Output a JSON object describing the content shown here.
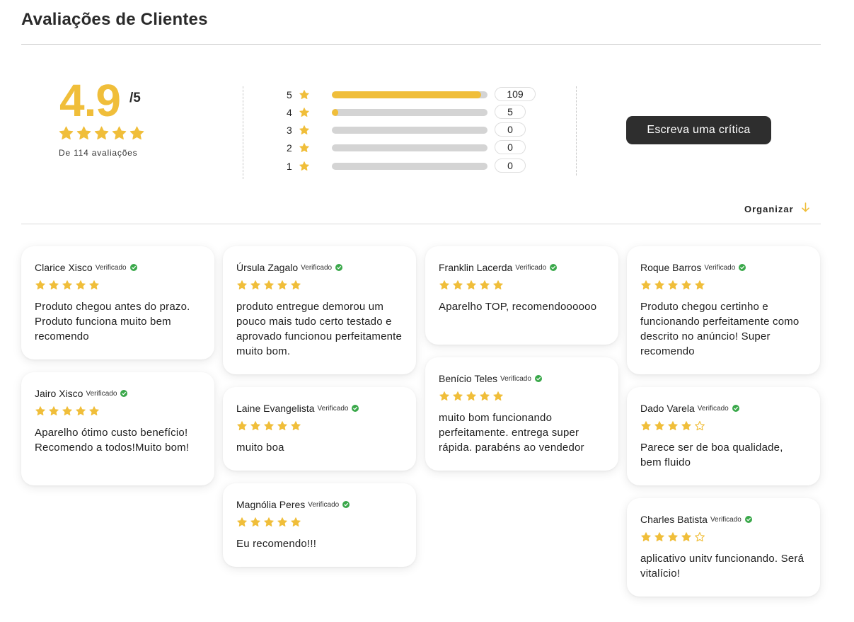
{
  "header": {
    "title": "Avaliações de Clientes"
  },
  "summary": {
    "score": "4.9",
    "score_max": "/5",
    "stars": 5,
    "count_text": "De 114 avaliações",
    "distribution": [
      {
        "label": "5",
        "count": "109",
        "fill": 0.96
      },
      {
        "label": "4",
        "count": "5",
        "fill": 0.04
      },
      {
        "label": "3",
        "count": "0",
        "fill": 0
      },
      {
        "label": "2",
        "count": "0",
        "fill": 0
      },
      {
        "label": "1",
        "count": "0",
        "fill": 0
      }
    ]
  },
  "actions": {
    "write_review": "Escreva uma crítica",
    "sort_label": "Organizar"
  },
  "verified_label": "Verificado",
  "colors": {
    "accent": "#f0be3a",
    "verified": "#3aa84a",
    "button": "#2e2e2e"
  },
  "reviews": [
    {
      "name": "Clarice Xisco",
      "stars": 5,
      "text": "Produto chegou antes do prazo. Produto funciona muito bem recomendo"
    },
    {
      "name": "Jairo Xisco",
      "stars": 5,
      "text": "Aparelho ótimo custo benefício! Recomendo a todos!Muito bom!"
    },
    {
      "name": "Úrsula Zagalo",
      "stars": 5,
      "text": "produto entregue demorou um pouco mais tudo certo testado e aprovado funcionou perfeitamente muito bom."
    },
    {
      "name": "Laine Evangelista",
      "stars": 5,
      "text": "muito boa"
    },
    {
      "name": "Magnólia Peres",
      "stars": 5,
      "text": "Eu recomendo!!!"
    },
    {
      "name": "Franklin Lacerda",
      "stars": 5,
      "text": "Aparelho TOP, recomendoooooo"
    },
    {
      "name": "Benício Teles",
      "stars": 5,
      "text": "muito bom funcionando perfeitamente. entrega super rápida. parabéns ao vendedor"
    },
    {
      "name": "Roque Barros",
      "stars": 5,
      "text": "Produto chegou certinho e funcionando perfeitamente como descrito no anúncio! Super recomendo"
    },
    {
      "name": "Dado Varela",
      "stars": 4,
      "text": "Parece ser de boa qualidade, bem fluido"
    },
    {
      "name": "Charles Batista",
      "stars": 4,
      "text": "aplicativo unitv funcionando. Será vitalício!"
    }
  ]
}
